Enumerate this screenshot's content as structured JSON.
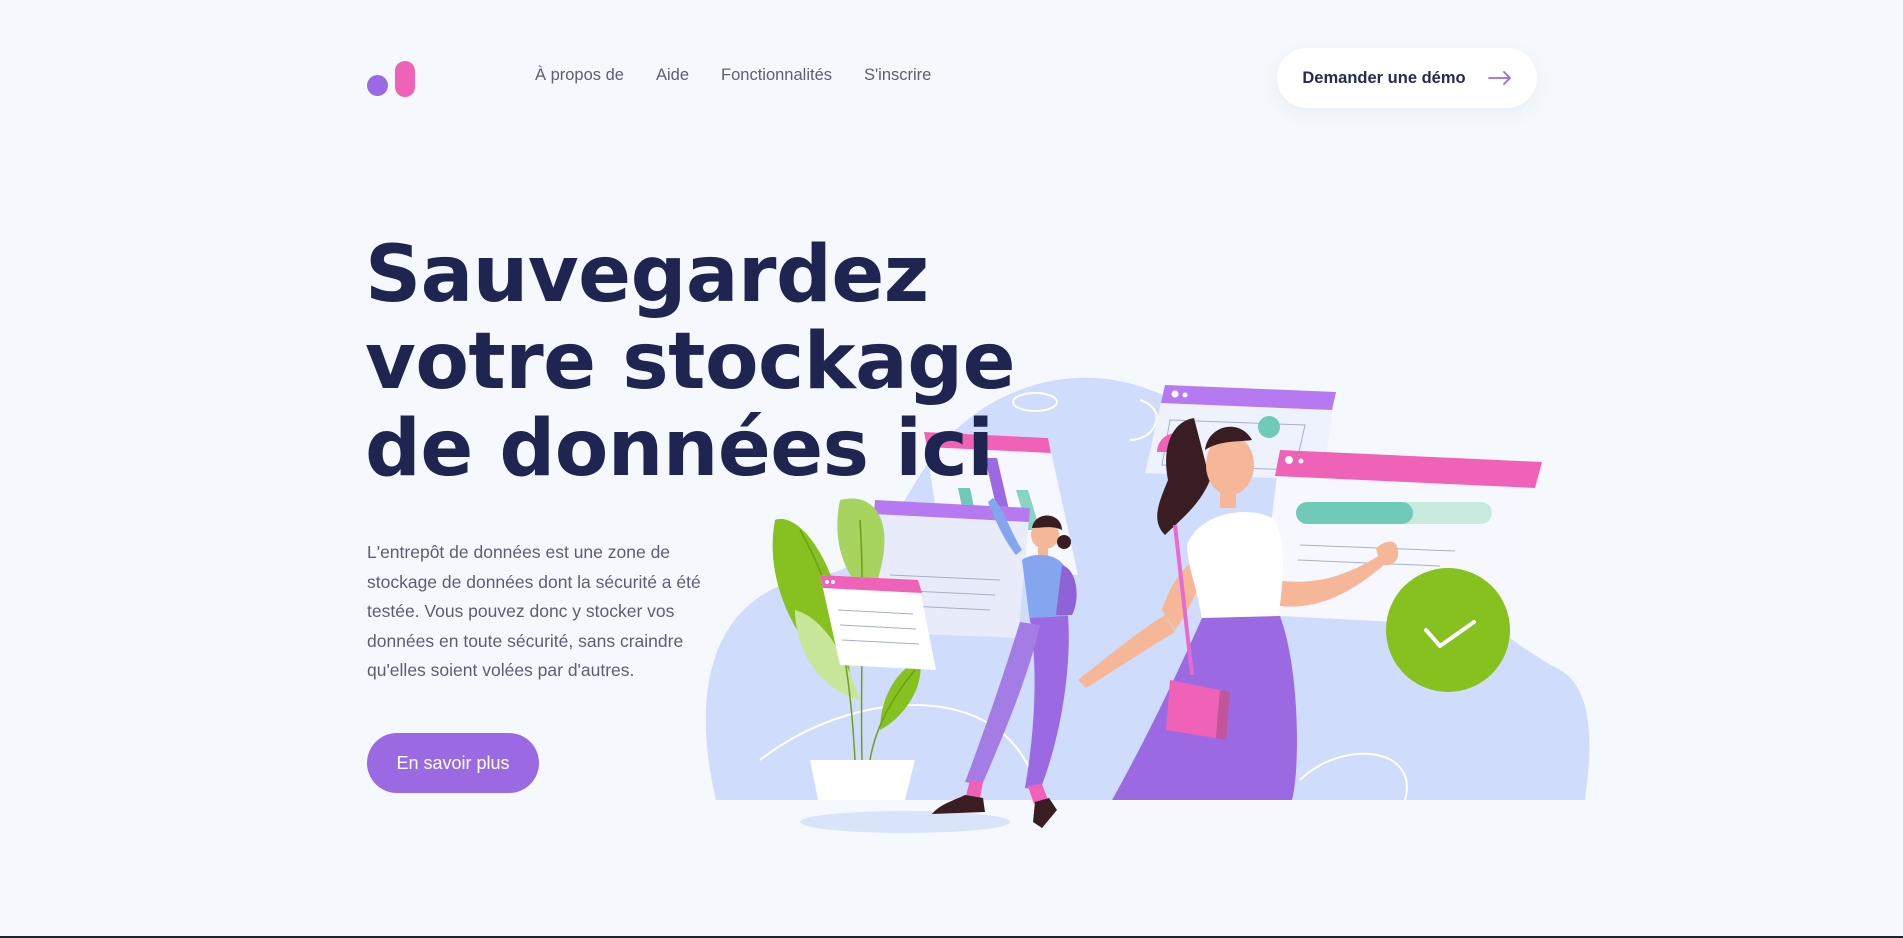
{
  "nav": {
    "items": [
      {
        "label": "À propos de"
      },
      {
        "label": "Aide"
      },
      {
        "label": "Fonctionnalités"
      },
      {
        "label": "S'inscrire"
      }
    ]
  },
  "header": {
    "demo_button": {
      "label": "Demander une démo",
      "icon": "arrow-right-icon"
    }
  },
  "hero": {
    "title_lines": [
      "Sauvegardez",
      "votre stockage",
      "de données ici"
    ],
    "description": "L'entrepôt de données est une zone de stockage de données dont la sécurité a été testée. Vous pouvez donc y stocker vos données en toute sécurité, sans craindre qu'elles soient volées par d'autres.",
    "cta_label": "En savoir plus"
  },
  "colors": {
    "background": "#f5f9fd",
    "navy": "#1f2451",
    "purple": "#9b6ae3",
    "pink": "#f061b8",
    "teal": "#6fcab8",
    "green": "#86c11f",
    "blob": "#cfdcfb"
  }
}
